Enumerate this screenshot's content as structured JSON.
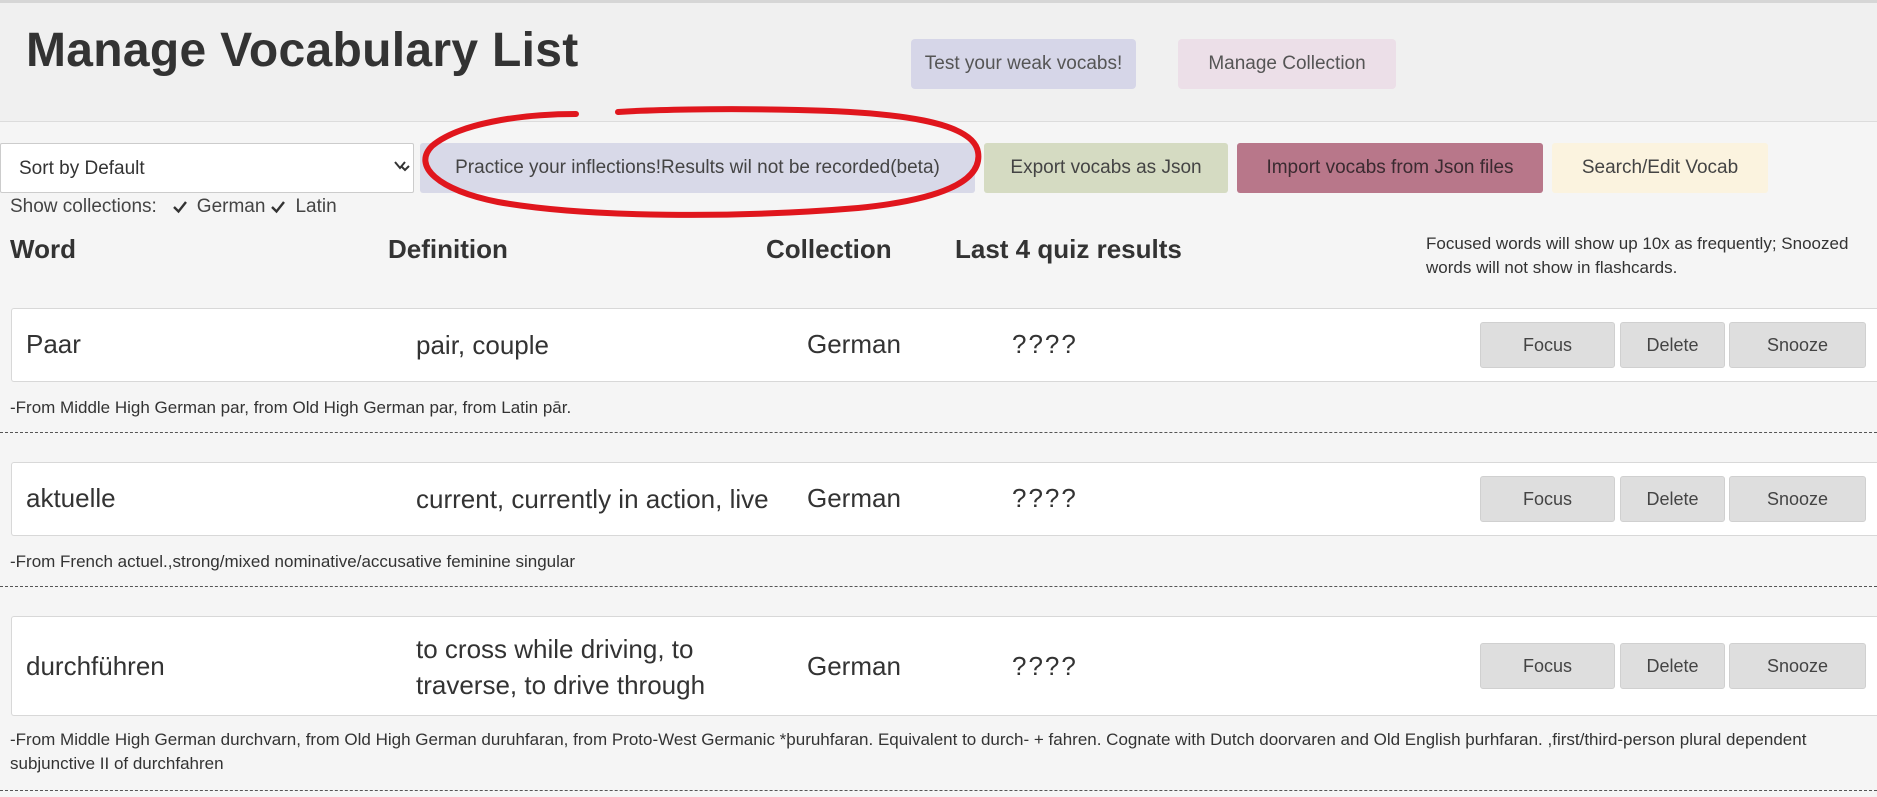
{
  "header": {
    "title": "Manage Vocabulary List",
    "test_weak_label": "Test your weak vocabs!",
    "manage_collection_label": "Manage Collection"
  },
  "controls": {
    "sort_options": [
      "Sort by Default"
    ],
    "sort_selected": "Sort by Default",
    "practice_label": "Practice your inflections!Results wil not be recorded(beta)",
    "export_label": "Export vocabs as Json",
    "import_label": "Import vocabs from Json files",
    "search_label": "Search/Edit Vocab"
  },
  "collections": {
    "label": "Show collections:",
    "items": [
      {
        "name": "German",
        "checked": true
      },
      {
        "name": "Latin",
        "checked": true
      }
    ]
  },
  "columns": {
    "word": "Word",
    "definition": "Definition",
    "collection": "Collection",
    "quiz": "Last 4 quiz results"
  },
  "help_text": "Focused words will show up 10x as frequently; Snoozed words will not show in flashcards.",
  "row_buttons": {
    "focus": "Focus",
    "delete": "Delete",
    "snooze": "Snooze"
  },
  "words": [
    {
      "word": "Paar",
      "definition": "pair, couple",
      "collection": "German",
      "quiz": "????",
      "etymology": "-From Middle High German par, from Old High German par, from Latin pār."
    },
    {
      "word": "aktuelle",
      "definition": "current, currently in action, live",
      "collection": "German",
      "quiz": "????",
      "etymology": "-From French actuel.,strong/mixed nominative/accusative feminine singular"
    },
    {
      "word": "durchführen",
      "definition": "to cross while driving, to traverse, to drive through",
      "collection": "German",
      "quiz": "????",
      "etymology": "-From Middle High German durchvarn, from Old High German duruhfaran, from Proto-West Germanic *þuruhfaran. Equivalent to durch- + fahren. Cognate with Dutch doorvaren and Old English þurhfaran. ,first/third-person plural dependent subjunctive II of durchfahren"
    }
  ],
  "colors": {
    "test_weak_bg": "#d6d6e8",
    "manage_collection_bg": "#ecdfe8",
    "practice_bg": "#d8d9e8",
    "export_bg": "#d5dbc2",
    "import_bg": "#b8778a",
    "search_bg": "#fbf3df",
    "annotation": "#e0161d"
  },
  "icons": {
    "select_arrow": "chevron-down-icon",
    "checkbox": "checkmark-icon",
    "annotation": "red-ellipse-annotation"
  }
}
